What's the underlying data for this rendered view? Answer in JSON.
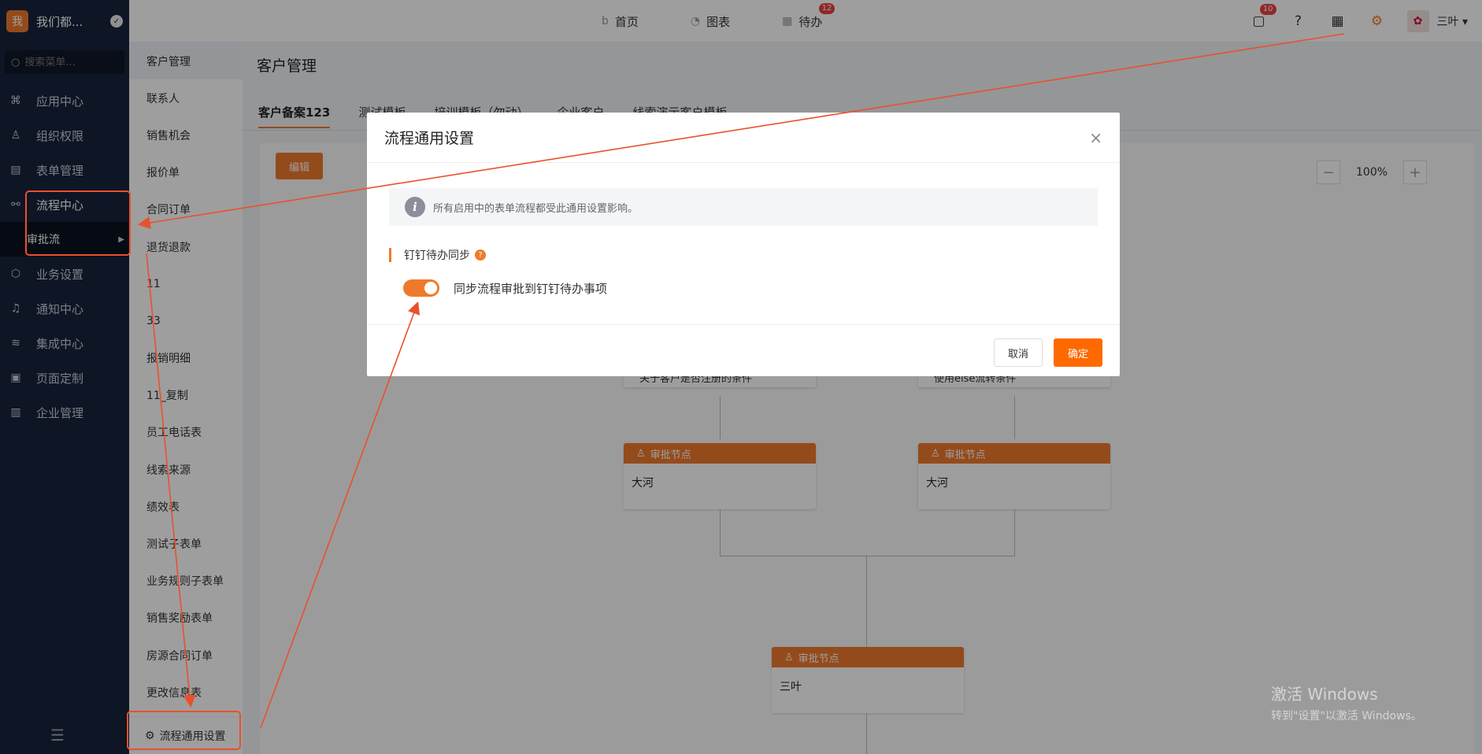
{
  "brand": {
    "logo_text": "我",
    "name": "我们都...",
    "badge": "✓"
  },
  "search": {
    "placeholder": "搜索菜单..."
  },
  "leftnav": {
    "items": [
      {
        "label": "应用中心",
        "icon": "apps-icon"
      },
      {
        "label": "组织权限",
        "icon": "user-icon"
      },
      {
        "label": "表单管理",
        "icon": "form-icon"
      },
      {
        "label": "流程中心",
        "icon": "flow-icon"
      },
      {
        "label": "业务设置",
        "icon": "cube-icon"
      },
      {
        "label": "通知中心",
        "icon": "bell-icon"
      },
      {
        "label": "集成中心",
        "icon": "layers-icon"
      },
      {
        "label": "页面定制",
        "icon": "layout-icon"
      },
      {
        "label": "企业管理",
        "icon": "building-icon"
      }
    ],
    "sub_active": "审批流"
  },
  "formlist": {
    "items": [
      "客户管理",
      "联系人",
      "销售机会",
      "报价单",
      "合同订单",
      "退货退款",
      "11",
      "33",
      "报销明细",
      "11_复制",
      "员工电话表",
      "线索来源",
      "绩效表",
      "测试子表单",
      "业务规则子表单",
      "销售奖励表单",
      "房源合同订单",
      "更改信息表"
    ],
    "footer": "流程通用设置"
  },
  "topbar": {
    "nav": [
      {
        "label": "首页",
        "icon": "home-icon"
      },
      {
        "label": "图表",
        "icon": "chart-icon"
      },
      {
        "label": "待办",
        "icon": "todo-icon",
        "count": "12"
      }
    ],
    "msg_count": "10",
    "username": "三叶"
  },
  "main": {
    "breadcrumb": "客户管理",
    "tabs": [
      "客户备案123",
      "测试模板",
      "培训模板（勿动）",
      "企业客户",
      "线索演示客户模板"
    ],
    "edit": "编辑",
    "zoom": "100%",
    "zoom_minus": "−",
    "zoom_plus": "+",
    "flow": {
      "cond_left": "关于客户是否注册的条件",
      "cond_right": "使用else流转条件",
      "node_header": "审批节点",
      "node_left": "大河",
      "node_right": "大河",
      "node_bottom": "三叶"
    }
  },
  "modal": {
    "title": "流程通用设置",
    "close": "×",
    "info": "所有启用中的表单流程都受此通用设置影响。",
    "info_icon": "i",
    "section": "钉钉待办同步",
    "help": "?",
    "toggle_label": "同步流程审批到钉钉待办事项",
    "toggle_on": true,
    "cancel": "取消",
    "ok": "确定"
  },
  "watermark": {
    "line1": "激活 Windows",
    "line2": "转到\"设置\"以激活 Windows。"
  },
  "colors": {
    "accent": "#ef7a2c",
    "annotation": "#e8512e",
    "nav_bg": "#17223a"
  }
}
